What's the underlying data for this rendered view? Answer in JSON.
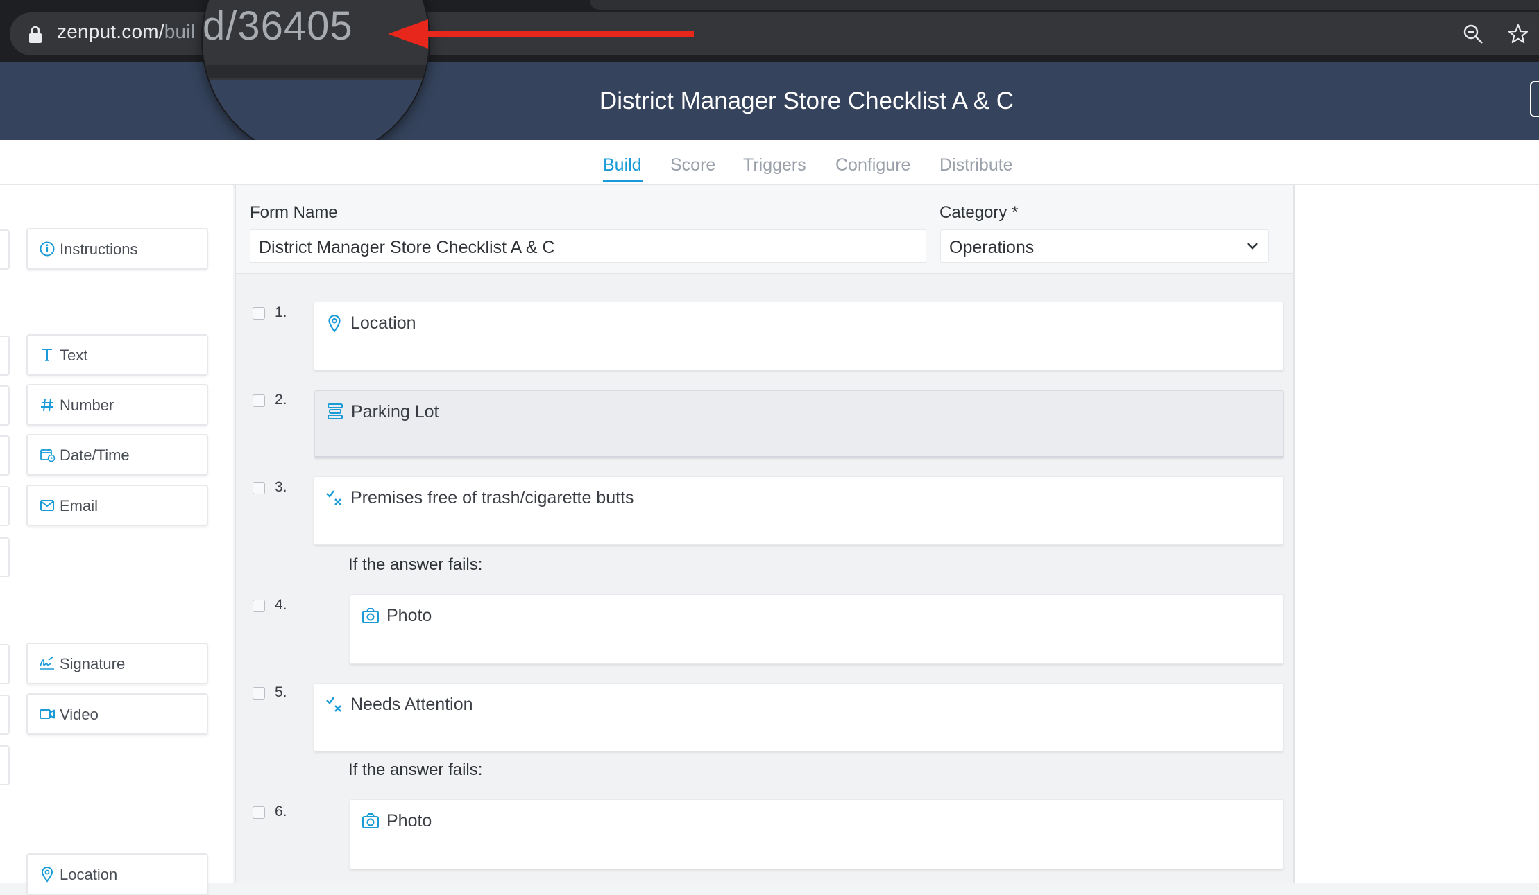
{
  "browser": {
    "url_main": "zenput.com/",
    "url_dim": "buil",
    "magnified_text": "d/36405"
  },
  "header": {
    "title": "District Manager Store Checklist A & C"
  },
  "tabs": [
    {
      "label": "Build"
    },
    {
      "label": "Score"
    },
    {
      "label": "Triggers"
    },
    {
      "label": "Configure"
    },
    {
      "label": "Distribute"
    }
  ],
  "palette": {
    "items": [
      {
        "label": "Instructions",
        "icon": "info-icon"
      },
      {
        "label": "Text",
        "icon": "text-icon"
      },
      {
        "label": "Number",
        "icon": "hash-icon"
      },
      {
        "label": "Date/Time",
        "icon": "calendar-icon"
      },
      {
        "label": "Email",
        "icon": "envelope-icon"
      },
      {
        "label": "Signature",
        "icon": "signature-icon"
      },
      {
        "label": "Video",
        "icon": "video-icon"
      },
      {
        "label": "Location",
        "icon": "location-pin-icon"
      }
    ]
  },
  "form": {
    "name_label": "Form Name",
    "name_value": "District Manager Store Checklist A & C",
    "category_label": "Category *",
    "category_value": "Operations"
  },
  "questions": [
    {
      "number": "1.",
      "label": "Location",
      "icon": "location-pin-icon"
    },
    {
      "number": "2.",
      "label": "Parking Lot",
      "icon": "section-icon"
    },
    {
      "number": "3.",
      "label": "Premises free of trash/cigarette butts",
      "icon": "pass-fail-icon"
    },
    {
      "number": "4.",
      "label": "Photo",
      "icon": "camera-icon"
    },
    {
      "number": "5.",
      "label": "Needs Attention",
      "icon": "pass-fail-icon"
    },
    {
      "number": "6.",
      "label": "Photo",
      "icon": "camera-icon"
    }
  ],
  "conditional_text": "If the answer fails:",
  "colors": {
    "accent": "#1a9bd7",
    "header_bg": "#35435c",
    "chrome_bg": "#35363a",
    "arrow": "#e8271c"
  }
}
